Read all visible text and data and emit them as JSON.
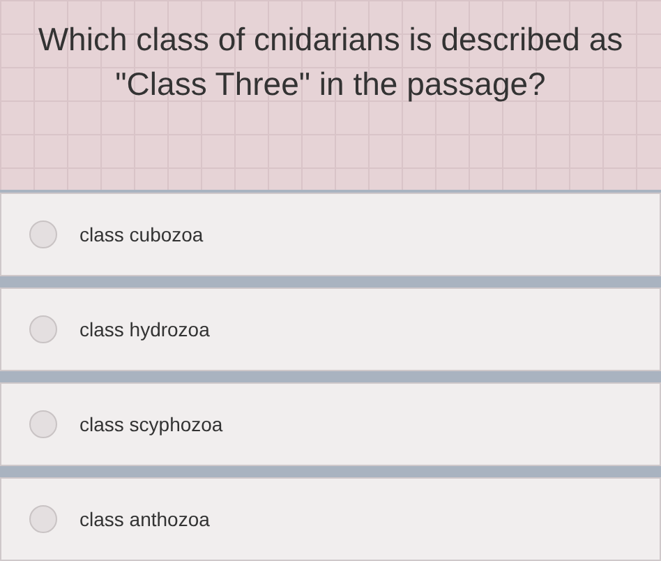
{
  "question": "Which class of cnidarians is described as \"Class Three\" in the passage?",
  "options": [
    {
      "label": "class cubozoa",
      "selected": false
    },
    {
      "label": "class hydrozoa",
      "selected": false
    },
    {
      "label": "class scyphozoa",
      "selected": false
    },
    {
      "label": "class anthozoa",
      "selected": false
    }
  ]
}
